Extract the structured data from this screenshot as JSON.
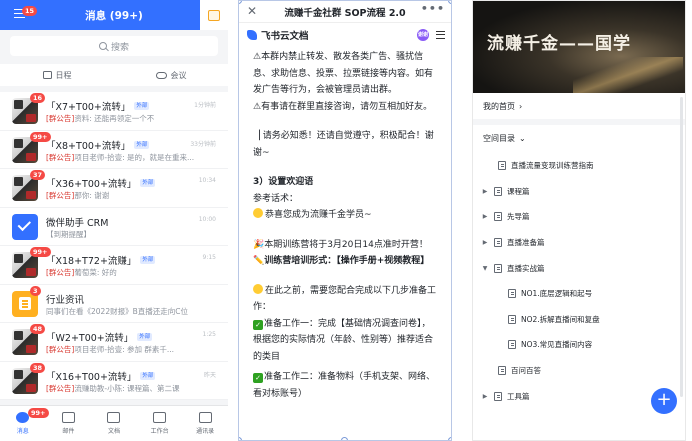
{
  "left": {
    "header_title": "消息 (99+)",
    "header_badge": "15",
    "search_placeholder": "搜索",
    "quick": [
      "日程",
      "会议"
    ],
    "chats": [
      {
        "title": "「X7+T00+流转」",
        "tag": "外部",
        "badge": "16",
        "time": "1分钟前",
        "gg": "[群公告]",
        "preview": "资料: 还能再领定一个不"
      },
      {
        "title": "「X8+T00+流转」",
        "tag": "外部",
        "badge": "99+",
        "time": "33分钟前",
        "gg": "[群公告]",
        "preview": "项目老师-拾壹: 是的，就是在重来..."
      },
      {
        "title": "「X36+T00+流转」",
        "tag": "外部",
        "badge": "37",
        "time": "10:34",
        "gg": "[群公告]",
        "preview": "那你: 谢谢"
      },
      {
        "title": "微伴助手 CRM",
        "tag": "",
        "badge": "",
        "time": "10:00",
        "gg": "",
        "preview": "【到期提醒】"
      },
      {
        "title": "「X18+T72+流赚」",
        "tag": "外部",
        "badge": "99+",
        "time": "9:15",
        "gg": "[群公告]",
        "preview": "葡萄菜: 好的"
      },
      {
        "title": "行业资讯",
        "tag": "",
        "badge": "3",
        "time": "",
        "gg": "",
        "preview": "同事们在看《2022财报》B直播还走向C位"
      },
      {
        "title": "「W2+T00+流转」",
        "tag": "外部",
        "badge": "48",
        "time": "1:25",
        "gg": "[群公告]",
        "preview": "项目老师-拾壹: 参加 群素千..."
      },
      {
        "title": "「X16+T00+流转」",
        "tag": "外部",
        "badge": "38",
        "time": "昨天",
        "gg": "[群公告]",
        "preview": "流赚助教-小陈: 课程篇、第二课"
      }
    ],
    "tabs": [
      {
        "label": "消息",
        "badge": "99+"
      },
      {
        "label": "邮件",
        "badge": ""
      },
      {
        "label": "文档",
        "badge": ""
      },
      {
        "label": "工作台",
        "badge": ""
      },
      {
        "label": "通讯录",
        "badge": ""
      }
    ]
  },
  "mid": {
    "title": "流赚千金社群 SOP流程 2.0",
    "brand": "飞书云文档",
    "avatar": "谢谢",
    "lines": {
      "l1": "⚠本群内禁止转发、散发各类广告、骚扰信息、求助信息、投票、拉票链接等内容。如有发广告等行为，会被管理员请出群。",
      "l2": "⚠有事请在群里直接咨询，请勿互相加好友。",
      "l3": "▕ 请务必知悉！还请自觉遵守，积极配合！谢谢~",
      "l4": "3）设置欢迎语",
      "l5": "参考话术：",
      "l6": "恭喜您成为流赚千金学员~",
      "l7": "🎉本期训练营将于3月20日14点准时开营！",
      "l8": "✏️训练营培训形式：【操作手册+视频教程】",
      "l9": "在此之前，需要您配合完成以下几步准备工作：",
      "l10": "准备工作一：完成【基础情况调查问卷】，根据您的实际情况（年龄、性别等）推荐适合的类目",
      "l11": "准备工作二：准备物料（手机支架、网络、看对标账号）"
    }
  },
  "right": {
    "hero_title": "流赚千金——国学",
    "home_link": "我的首页",
    "space": "空间目录",
    "tree": [
      {
        "label": "直播流量变现训练营指南",
        "arrow": "",
        "level": 1
      },
      {
        "label": "课程篇",
        "arrow": "▶",
        "level": 0
      },
      {
        "label": "先导篇",
        "arrow": "▶",
        "level": 0
      },
      {
        "label": "直播准备篇",
        "arrow": "▶",
        "level": 0
      },
      {
        "label": "直播实战篇",
        "arrow": "▼",
        "level": 0
      },
      {
        "label": "NO1.底层逻辑和起号",
        "arrow": "",
        "level": 2
      },
      {
        "label": "NO2.拆解直播间和复盘",
        "arrow": "",
        "level": 2
      },
      {
        "label": "NO3.常见直播间内容",
        "arrow": "",
        "level": 2
      },
      {
        "label": "百问百答",
        "arrow": "",
        "level": 1
      },
      {
        "label": "工具篇",
        "arrow": "▶",
        "level": 0
      }
    ],
    "fab": "+"
  }
}
